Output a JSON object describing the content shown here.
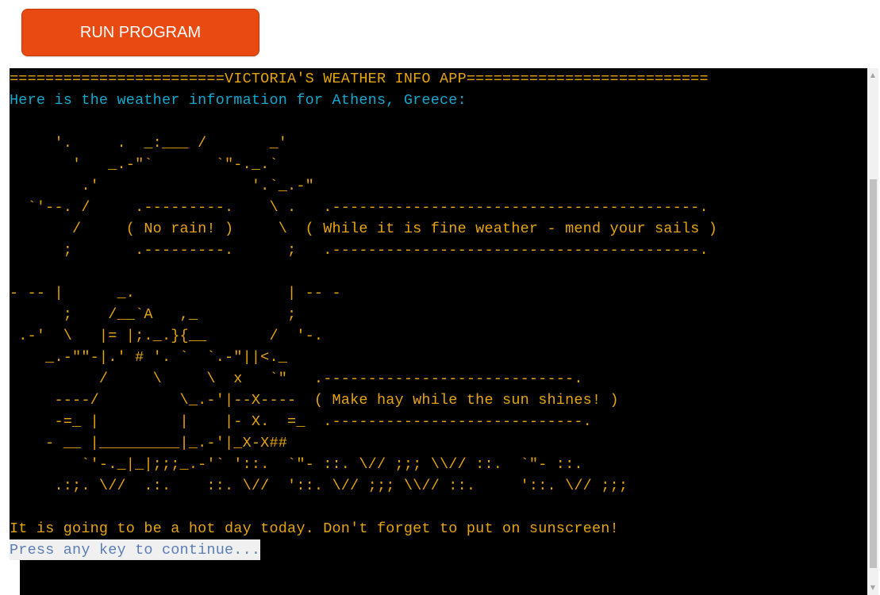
{
  "run_button": {
    "label": "RUN PROGRAM"
  },
  "terminal": {
    "title_line": "========================VICTORIA'S WEATHER INFO APP===========================",
    "intro_line": "Here is the weather information for Athens, Greece:",
    "art_lines": [
      "     '.     .  _:___ /       _'",
      "       '   _.-\"`       `\"-._.`",
      "        .'                 '.`_.-\"",
      "  `'--. /     .---------.    \\ .   .-----------------------------------------.",
      "       /     ( No rain! )     \\  ( While it is fine weather - mend your sails )",
      "      ;       .---------.      ;   .-----------------------------------------.",
      "",
      "- -- |      _.                 | -- -",
      "      ;    /__`A   ,_          ;",
      " .-'  \\   |= |;._.}{__       /  '-.",
      "    _.-\"\"-|.' # '. `  `.-\"||<._",
      "          /     \\     \\  x   `\"   .----------------------------.",
      "     ----/         \\_.-'|--X----  ( Make hay while the sun shines! )",
      "     -=_ |         |    |- X.  =_  .----------------------------.",
      "    - __ |_________|_.-'|_X-X##",
      "        `'-._|_|;;;_.-'` '::.  `\"- ::. \\// ;;; \\\\// ::.  `\"- ::.",
      "     .:;. \\//  .:.    ::. \\//  '::. \\// ;;; \\\\// ::.     '::. \\// ;;;"
    ],
    "message_line": "It is going to be a hot day today. Don't forget to put on sunscreen!",
    "prompt_line": "Press any key to continue..."
  },
  "colors": {
    "button_bg": "#e84a11",
    "terminal_bg": "#000000",
    "text_gold": "#e5a50a",
    "text_teal": "#11a8cd"
  },
  "icons": {
    "scroll_up": "triangle-up-icon",
    "scroll_down": "triangle-down-icon"
  }
}
